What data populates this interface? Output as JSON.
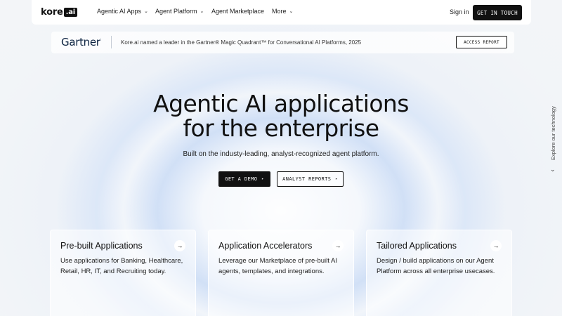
{
  "nav": {
    "logo_text": "kore",
    "logo_box": ".ai",
    "items": [
      {
        "label": "Agentic AI Apps",
        "has_dropdown": true
      },
      {
        "label": "Agent Platform",
        "has_dropdown": true
      },
      {
        "label": "Agent Marketplace",
        "has_dropdown": false
      },
      {
        "label": "More",
        "has_dropdown": true
      }
    ],
    "signin": "Sign in",
    "cta": "GET IN TOUCH"
  },
  "banner": {
    "brand": "Gartner",
    "text": "Kore.ai named a leader in the Gartner® Magic Quadrant™ for Conversational AI Platforms, 2025",
    "button": "ACCESS REPORT"
  },
  "hero": {
    "title_line1": "Agentic AI applications",
    "title_line2": "for the enterprise",
    "subtitle": "Built on the industy-leading, analyst-recognized agent platform.",
    "primary_button": "GET A DEMO",
    "secondary_button": "ANALYST REPORTS"
  },
  "side": {
    "label": "Explore our technology"
  },
  "cards": [
    {
      "title": "Pre-built Applications",
      "description": "Use applications for Banking, Healthcare, Retail, HR, IT, and Recruiting today."
    },
    {
      "title": "Application Accelerators",
      "description": "Leverage our Marketplace of pre-built AI agents, templates, and integrations."
    },
    {
      "title": "Tailored Applications",
      "description": "Design / build applications on our Agent Platform across all enterprise usecases."
    }
  ],
  "colors": {
    "primary_dark": "#111111",
    "gartner_navy": "#0b2240"
  }
}
